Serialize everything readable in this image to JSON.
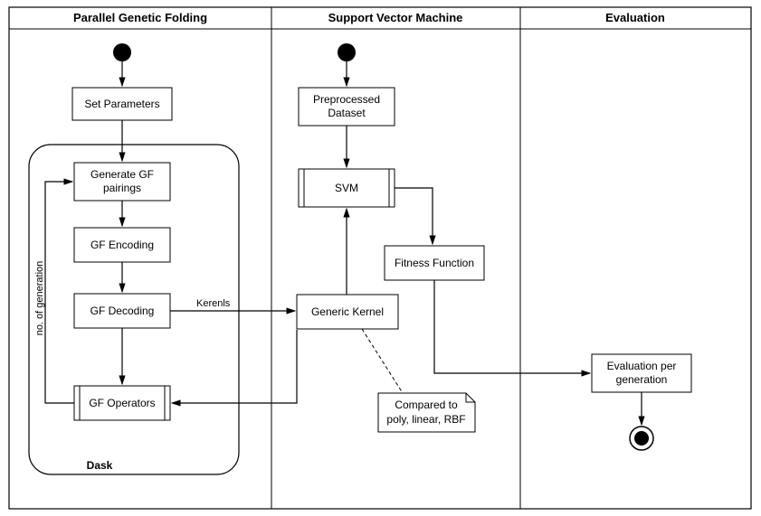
{
  "lanes": {
    "lane1": "Parallel Genetic Folding",
    "lane2": "Support Vector Machine",
    "lane3": "Evaluation"
  },
  "boxes": {
    "setParams": "Set Parameters",
    "genPairL1": "Generate GF",
    "genPairL2": "pairings",
    "gfEncoding": "GF Encoding",
    "gfDecoding": "GF Decoding",
    "gfOperators": "GF Operators",
    "preprocL1": "Preprocessed",
    "preprocL2": "Dataset",
    "svm": "SVM",
    "fitness": "Fitness Function",
    "genericKernel": "Generic Kernel",
    "noteL1": "Compared to",
    "noteL2": "poly, linear, RBF",
    "daskLabel": "Dask",
    "evalL1": "Evaluation per",
    "evalL2": "generation"
  },
  "labels": {
    "kernels": "Kerenls",
    "noGen": "no. of generation"
  },
  "colors": {
    "stroke": "#000000",
    "fill": "#ffffff"
  }
}
